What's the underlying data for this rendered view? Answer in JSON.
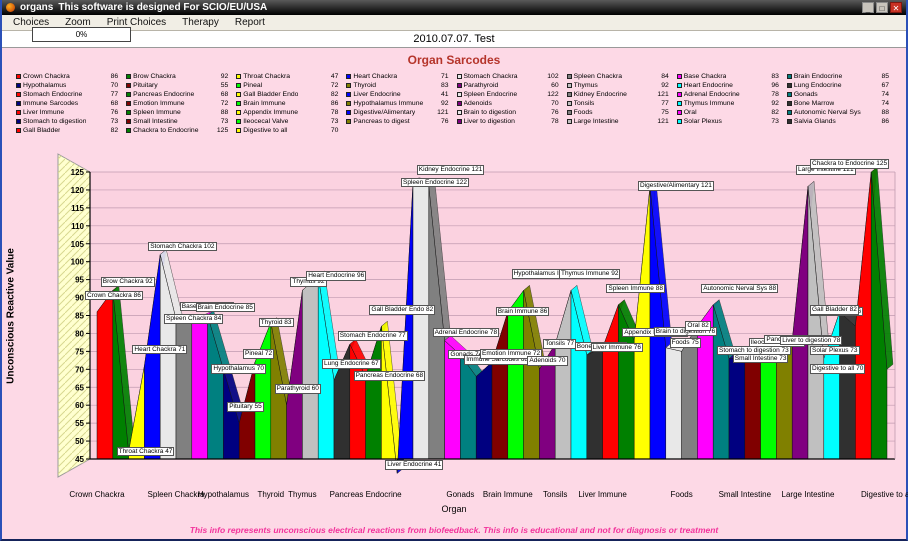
{
  "window": {
    "title_app": "organs",
    "title_note": "This software is designed For SCIO/EU/USA",
    "buttons": {
      "minimize": "_",
      "maximize": "□",
      "close": "✕"
    },
    "menu_items": [
      "Choices",
      "Zoom",
      "Print Choices",
      "Therapy",
      "Report"
    ],
    "progress": "0%",
    "date_label": "2010.07.07. Test"
  },
  "chart": {
    "title": "Organ Sarcodes",
    "y_axis_label": "Unconscious Reactive Value",
    "x_axis_label": "Organ",
    "disclaimer": "This info represents unconscious electrical reactions from biofeedback. This info is educational and not for diagnosis or treatment"
  },
  "chart_data": {
    "type": "area",
    "title": "Organ Sarcodes",
    "xlabel": "Organ",
    "ylabel": "Unconscious Reactive Value",
    "ylim": [
      45,
      125
    ],
    "y_tick_step": 5,
    "grid": true,
    "legend_position": "top",
    "categories": [
      "Crown Chackra",
      "Brow Chackra",
      "Throat Chackra",
      "Heart Chackra",
      "Stomach Chackra",
      "Spleen Chackra",
      "Base Chackra",
      "Brain Endocrine",
      "Hypothalamus",
      "Pituitary",
      "Pineal",
      "Thyroid",
      "Parathyroid",
      "Thymus",
      "Heart Endocrine",
      "Lung Endocrine",
      "Stomach Endocrine",
      "Pancreas Endocrine",
      "Gall Bladder Endo",
      "Liver Endocrine",
      "Spleen Endocrine",
      "Kidney Endocrine",
      "Adrenal Endocrine",
      "Gonads",
      "Immune Sarcodes",
      "Emotion Immune",
      "Brain Immune",
      "Hypothalamus Immune",
      "Adenoids",
      "Tonsils",
      "Thymus Immune",
      "Bone Marrow",
      "Liver Immune",
      "Spleen Immune",
      "Appendix Immune",
      "Digestive/Alimentary",
      "Brain to digestion",
      "Foods",
      "Oral",
      "Autonomic Nerval Sys",
      "Stomach to digestion",
      "Small Intestine",
      "Ileocecal Valve",
      "Pancreas to digest",
      "Liver to digestion",
      "Large Intestine",
      "Solar Plexus",
      "Salvia Glands",
      "Gall Bladder",
      "Chackra to Endocrine",
      "Digestive to all"
    ],
    "values": [
      86,
      92,
      47,
      71,
      102,
      84,
      83,
      85,
      70,
      55,
      72,
      83,
      60,
      92,
      96,
      67,
      77,
      68,
      82,
      41,
      122,
      121,
      78,
      74,
      68,
      72,
      86,
      92,
      70,
      77,
      92,
      74,
      76,
      88,
      78,
      121,
      76,
      75,
      82,
      88,
      73,
      73,
      73,
      76,
      78,
      121,
      73,
      86,
      82,
      125,
      70
    ],
    "x_tick_labels": [
      "Crown Chackra",
      "Spleen Chackra",
      "Hypothalamus",
      "Thyroid",
      "Thymus",
      "Pancreas Endocrine",
      "Gonads",
      "Brain Immune",
      "Tonsils",
      "Liver Immune",
      "Foods",
      "Small Intestine",
      "Large Intestine",
      "Digestive to all"
    ],
    "x_tick_indices": [
      0,
      5,
      8,
      11,
      13,
      17,
      23,
      26,
      29,
      32,
      37,
      41,
      45,
      50
    ],
    "palette": [
      "#ff0000",
      "#008000",
      "#ffff00",
      "#0000ff",
      "#e8e8e8",
      "#808080",
      "#ff00ff",
      "#008080",
      "#000080",
      "#800000",
      "#00ff00",
      "#808000",
      "#800080",
      "#c0c0c0",
      "#00ffff",
      "#303030"
    ],
    "colors": {
      "plot_bg": "#fbd2e0",
      "wall": "#ffffcf",
      "gridline": "#c09ab0",
      "title": "#b5342a",
      "disclaimer": "#f3339c"
    }
  }
}
